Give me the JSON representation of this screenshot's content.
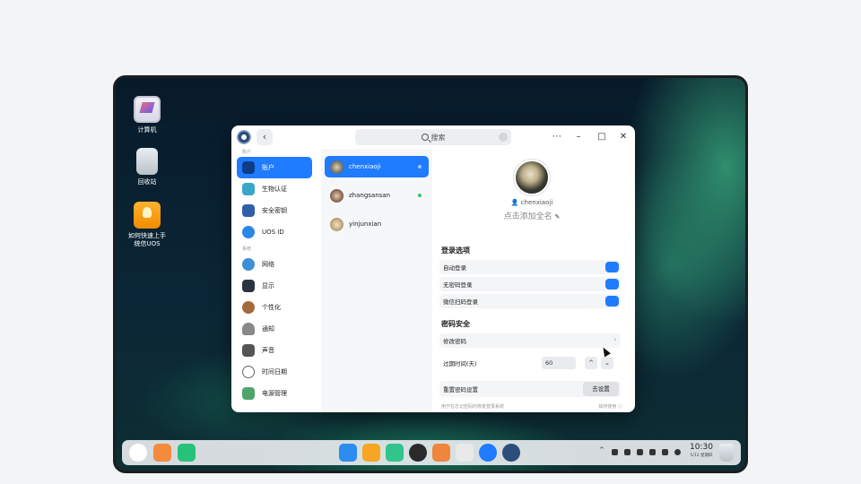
{
  "desktop": {
    "icons": [
      {
        "label": "计算机",
        "icon": "computer-icon"
      },
      {
        "label": "回收站",
        "icon": "trash-icon"
      },
      {
        "label": "如何快速上手",
        "label2": "统信UOS",
        "icon": "guide-icon"
      }
    ]
  },
  "window": {
    "search_placeholder": "搜索",
    "back_glyph": "‹",
    "menu_glyph": "⋯",
    "minimize_glyph": "–",
    "maximize_glyph": "□",
    "close_glyph": "✕",
    "sidebar": {
      "section_account": "账户",
      "section_system": "系统",
      "items": [
        {
          "label": "账户",
          "icon": "account-icon",
          "color": "#1f7bff"
        },
        {
          "label": "生物认证",
          "icon": "biometric-icon",
          "color": "#3aa6c9"
        },
        {
          "label": "安全密钥",
          "icon": "security-key-icon",
          "color": "#2f5fa8"
        },
        {
          "label": "UOS ID",
          "icon": "cloud-icon",
          "color": "#2c86e8"
        },
        {
          "label": "网络",
          "icon": "network-icon",
          "color": "#3d8fd6"
        },
        {
          "label": "显示",
          "icon": "display-icon",
          "color": "#2b3340"
        },
        {
          "label": "个性化",
          "icon": "personalization-icon",
          "color": "#a46a3d"
        },
        {
          "label": "通知",
          "icon": "notification-icon",
          "color": "#888888"
        },
        {
          "label": "声音",
          "icon": "sound-icon",
          "color": "#555555"
        },
        {
          "label": "时间日期",
          "icon": "clock-icon",
          "color": "#666666"
        },
        {
          "label": "电源管理",
          "icon": "power-icon",
          "color": "#4fa66b"
        }
      ]
    },
    "users": [
      {
        "name": "chenxiaoji",
        "status": "current"
      },
      {
        "name": "zhangsansan",
        "status": "online"
      },
      {
        "name": "yinjunxian",
        "status": ""
      }
    ],
    "detail": {
      "username": "chenxiaoji",
      "fullname_placeholder": "点击添加全名",
      "login_options_title": "登录选项",
      "login_options": [
        {
          "label": "自动登录",
          "enabled": true
        },
        {
          "label": "无密码登录",
          "enabled": true
        },
        {
          "label": "微信扫码登录",
          "enabled": true
        }
      ],
      "password_security_title": "密码安全",
      "change_password": "修改密码",
      "expiry_label": "过期时间(天)",
      "expiry_value": "60",
      "reset_label": "重置密码设置",
      "reset_button": "去设置",
      "hint": "用于在忘记密码时修复登录系统",
      "hint_link": "如何使用"
    }
  },
  "dock": {
    "apps": [
      {
        "icon": "launcher-icon",
        "color": "#ffffff"
      },
      {
        "icon": "multitask-icon",
        "color": "#f28b3c"
      },
      {
        "icon": "workspace-icon",
        "color": "#27c27a"
      },
      {
        "icon": "file-manager-icon",
        "color": "#2d8cf0"
      },
      {
        "icon": "app-store-icon",
        "color": "#f6a623"
      },
      {
        "icon": "music-icon",
        "color": "#31c48d"
      },
      {
        "icon": "video-icon",
        "color": "#2a2a2a"
      },
      {
        "icon": "photos-icon",
        "color": "#f0863c"
      },
      {
        "icon": "camera-icon",
        "color": "#e9e9e9"
      },
      {
        "icon": "browser-icon",
        "color": "#1f7bff"
      },
      {
        "icon": "settings-icon",
        "color": "#2d4d7a"
      }
    ],
    "clock_time": "10:30",
    "clock_date": "5/12 星期四"
  }
}
